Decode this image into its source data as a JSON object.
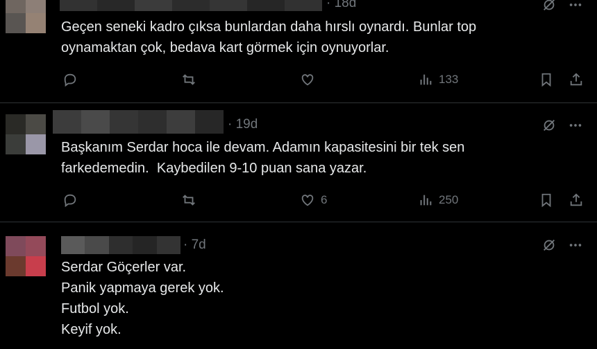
{
  "tweets": [
    {
      "time": "· 18d",
      "text": "Geçen seneki kadro çıksa bunlardan daha hırslı oynardı. Bunlar top\noynamaktan çok, bedava kart görmek için oynuyorlar.",
      "likes": "",
      "views": "133",
      "avatar_colors": [
        "#6f6660",
        "#8d7f77",
        "#595552",
        "#958274"
      ],
      "name_colors": [
        "#323232",
        "#282828",
        "#3b3b3b",
        "#2c2c2c",
        "#353535",
        "#262626",
        "#313131"
      ]
    },
    {
      "time": "· 19d",
      "text": "Başkanım Serdar hoca ile devam. Adamın kapasitesini bir tek sen\nfarkedemedin.  Kaybedilen 9-10 puan sana yazar.",
      "likes": "6",
      "views": "250",
      "avatar_colors": [
        "#2a2a26",
        "#4b4a45",
        "#3b3d3a",
        "#9a97a8"
      ],
      "name_colors": [
        "#3c3c3c",
        "#4a4a4a",
        "#353535",
        "#2e2e2e",
        "#3d3d3d",
        "#272727"
      ]
    },
    {
      "time": "· 7d",
      "text": "Serdar Göçerler var.\nPanik yapmaya gerek yok.\nFutbol yok.\nKeyif yok.",
      "avatar_colors": [
        "#7f4a5b",
        "#944a5a",
        "#6b3a2e",
        "#c83e4c"
      ],
      "name_colors": [
        "#5a5a5a",
        "#4a4a4a",
        "#2e2e2e",
        "#252525",
        "#333333"
      ]
    }
  ]
}
